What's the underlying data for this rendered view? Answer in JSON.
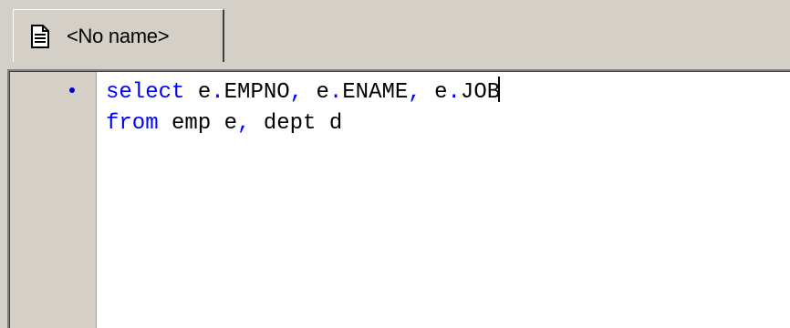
{
  "tab": {
    "label": "<No name>",
    "icon": "document-icon"
  },
  "editor": {
    "line1": {
      "keyword": "select",
      "parts": [
        " e",
        ".",
        "EMPNO",
        ",",
        " e",
        ".",
        "ENAME",
        ",",
        " e",
        ".",
        "JOB"
      ]
    },
    "line2": {
      "keyword": "from",
      "parts": [
        " emp e",
        ",",
        " dept d"
      ]
    }
  },
  "colors": {
    "keyword": "#0000ff",
    "text": "#000000",
    "marker": "#0000e0",
    "chrome": "#d4d0c8"
  }
}
